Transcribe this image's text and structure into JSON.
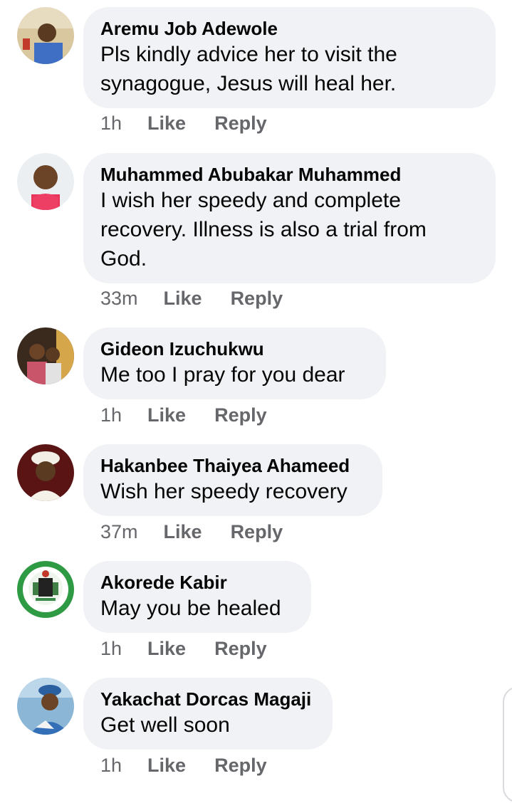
{
  "comments": [
    {
      "name": "Aremu Job Adewole",
      "text": "Pls kindly advice her to visit the synagogue, Jesus will heal her.",
      "time": "1h",
      "like": "Like",
      "reply": "Reply"
    },
    {
      "name": "Muhammed Abubakar Muhammed",
      "text": "I wish her speedy and complete recovery. Illness is also a trial from God.",
      "time": "33m",
      "like": "Like",
      "reply": "Reply"
    },
    {
      "name": "Gideon Izuchukwu",
      "text": "Me too I pray for you dear",
      "time": "1h",
      "like": "Like",
      "reply": "Reply"
    },
    {
      "name": "Hakanbee Thaiyea Ahameed",
      "text": "Wish her speedy recovery",
      "time": "37m",
      "like": "Like",
      "reply": "Reply"
    },
    {
      "name": "Akorede Kabir",
      "text": "May you be healed",
      "time": "1h",
      "like": "Like",
      "reply": "Reply"
    },
    {
      "name": "Yakachat Dorcas Magaji",
      "text": "Get well soon",
      "time": "1h",
      "like": "Like",
      "reply": "Reply"
    }
  ],
  "colors": {
    "bubble": "#f0f2f5",
    "name_text": "#050505",
    "meta_text": "#65676b"
  },
  "icons": {
    "avatar": "profile-photo"
  }
}
